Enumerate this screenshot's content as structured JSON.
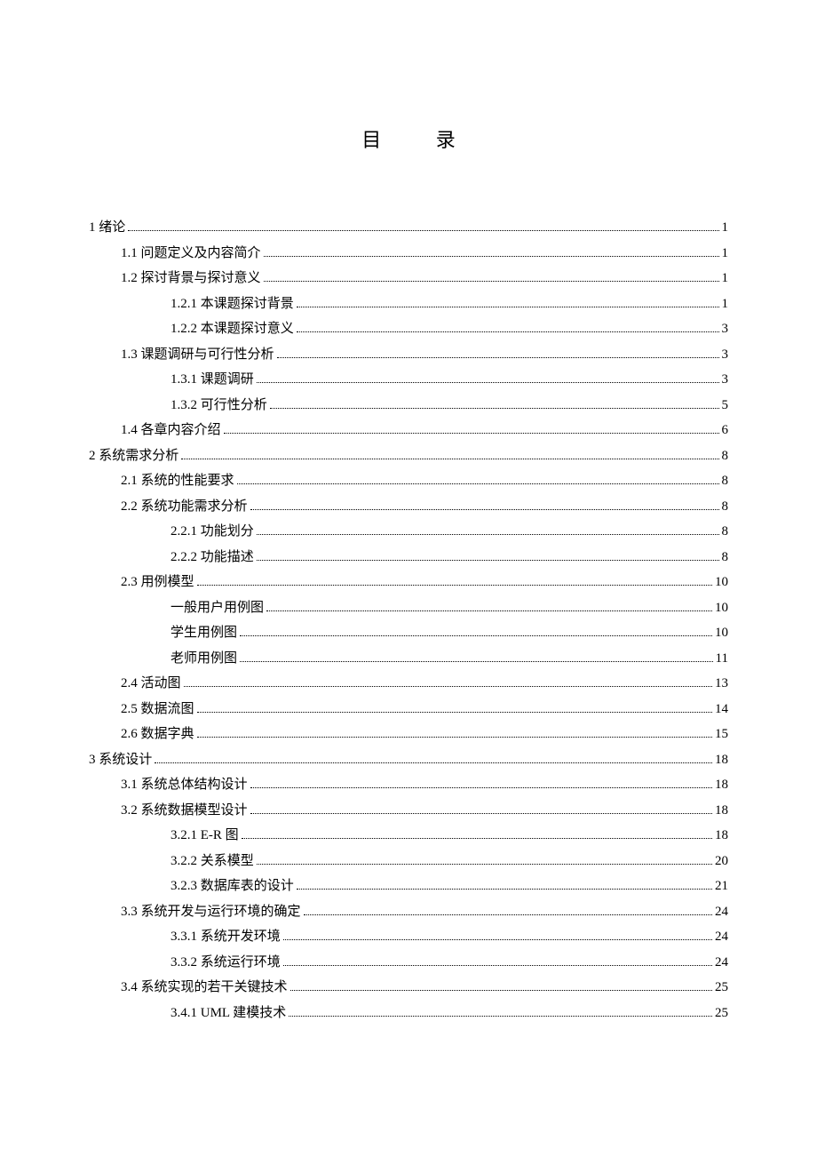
{
  "title": "目  录",
  "toc": [
    {
      "indent": 0,
      "label": "1 绪论",
      "page": "1"
    },
    {
      "indent": 1,
      "label": "1.1 问题定义及内容简介",
      "page": "1"
    },
    {
      "indent": 1,
      "label": "1.2 探讨背景与探讨意义",
      "page": "1"
    },
    {
      "indent": 2,
      "label": "1.2.1 本课题探讨背景",
      "page": "1"
    },
    {
      "indent": 2,
      "label": "1.2.2 本课题探讨意义",
      "page": "3"
    },
    {
      "indent": 1,
      "label": "1.3 课题调研与可行性分析",
      "page": "3"
    },
    {
      "indent": 2,
      "label": "1.3.1 课题调研",
      "page": "3"
    },
    {
      "indent": 2,
      "label": "1.3.2 可行性分析",
      "page": "5"
    },
    {
      "indent": 1,
      "label": "1.4 各章内容介绍",
      "page": "6"
    },
    {
      "indent": 0,
      "label": "2  系统需求分析",
      "page": "8"
    },
    {
      "indent": 1,
      "label": "2.1 系统的性能要求",
      "page": "8"
    },
    {
      "indent": 1,
      "label": "2.2 系统功能需求分析",
      "page": "8"
    },
    {
      "indent": 2,
      "label": "2.2.1 功能划分",
      "page": "8"
    },
    {
      "indent": 2,
      "label": "2.2.2 功能描述",
      "page": "8"
    },
    {
      "indent": 1,
      "label": "2.3 用例模型",
      "page": "10"
    },
    {
      "indent": 2,
      "label": "一般用户用例图",
      "page": "10"
    },
    {
      "indent": 2,
      "label": "学生用例图",
      "page": "10"
    },
    {
      "indent": 2,
      "label": "老师用例图",
      "page": "11"
    },
    {
      "indent": 1,
      "label": "2.4 活动图",
      "page": "13"
    },
    {
      "indent": 1,
      "label": "2.5 数据流图",
      "page": "14"
    },
    {
      "indent": 1,
      "label": "2.6 数据字典",
      "page": "15"
    },
    {
      "indent": 0,
      "label": "3 系统设计",
      "page": "18"
    },
    {
      "indent": 1,
      "label": "3.1 系统总体结构设计",
      "page": "18"
    },
    {
      "indent": 1,
      "label": "3.2 系统数据模型设计",
      "page": "18"
    },
    {
      "indent": 2,
      "label": "3.2.1 E-R 图",
      "page": "18"
    },
    {
      "indent": 2,
      "label": "3.2.2 关系模型",
      "page": "20"
    },
    {
      "indent": 2,
      "label": "3.2.3 数据库表的设计",
      "page": "21"
    },
    {
      "indent": 1,
      "label": "3.3 系统开发与运行环境的确定",
      "page": "24"
    },
    {
      "indent": 2,
      "label": "3.3.1  系统开发环境",
      "page": "24"
    },
    {
      "indent": 2,
      "label": "3.3.2  系统运行环境",
      "page": "24"
    },
    {
      "indent": 1,
      "label": "3.4 系统实现的若干关键技术",
      "page": "25"
    },
    {
      "indent": 2,
      "label": "3.4.1 UML 建模技术",
      "page": "25"
    }
  ]
}
